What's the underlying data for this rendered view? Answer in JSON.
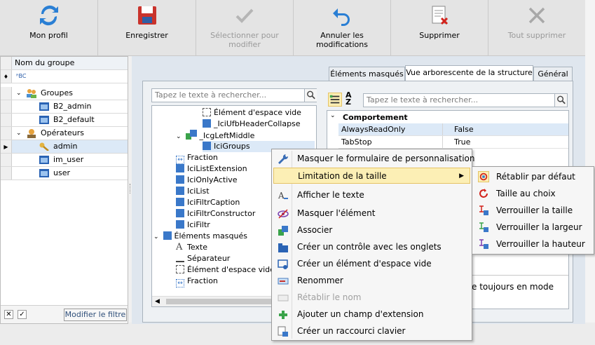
{
  "toolbar": {
    "mon_profil": "Mon profil",
    "enregistrer": "Enregistrer",
    "selectionner": "Sélectionner pour modifier",
    "annuler": "Annuler les modifications",
    "supprimer": "Supprimer",
    "tout_supprimer": "Tout supprimer"
  },
  "left_panel": {
    "header": "Nom du groupe",
    "filter_icon_text": "ᴿBC",
    "rows": {
      "groupes": "Groupes",
      "b2_admin": "B2_admin",
      "b2_default": "B2_default",
      "operateurs": "Opérateurs",
      "admin": "admin",
      "im_user": "im_user",
      "user": "user"
    },
    "modifier_filtre": "Modifier le filtre"
  },
  "tabs": {
    "elements_masques": "Éléments masqués",
    "vue_arborescente": "Vue arborescente de la structure",
    "general": "Général"
  },
  "tree_search_placeholder": "Tapez le texte à rechercher...",
  "props_search_placeholder": "Tapez le texte à rechercher...",
  "tree": {
    "element_espace_vide_1": "Élément d'espace vide",
    "ici_ufb_header_collapse": "_IciUfbHeaderCollapse",
    "icg_left_middle": "_IcgLeftMiddle",
    "ici_groups": "IciGroups",
    "fraction_1": "Fraction",
    "ici_list_extension": "IciListExtension",
    "ici_only_active": "IciOnlyActive",
    "ici_list": "IciList",
    "ici_filtr_caption": "IciFiltrCaption",
    "ici_filtr_constructor": "IciFiltrConstructor",
    "ici_filtr": "IciFiltr",
    "elements_masques": "Éléments masqués",
    "texte": "Texte",
    "separateur": "Séparateur",
    "element_espace_vide_2": "Élément d'espace vide",
    "fraction_2": "Fraction"
  },
  "props": {
    "category": "Comportement",
    "rows": [
      {
        "name": "AlwaysReadOnly",
        "value": "False"
      },
      {
        "name": "TabStop",
        "value": "True"
      }
    ],
    "description_fragment": "e toujours en mode"
  },
  "context_menu": {
    "masquer_formulaire": "Masquer le formulaire de personnalisation",
    "limitation_taille": "Limitation de la taille",
    "afficher_texte": "Afficher le texte",
    "masquer_element": "Masquer l'élément",
    "associer": "Associer",
    "creer_controle_onglets": "Créer un contrôle avec les onglets",
    "creer_element_espace_vide": "Créer un élément d'espace vide",
    "renommer": "Renommer",
    "retablir_nom": "Rétablir le nom",
    "ajouter_champ_extension": "Ajouter un champ d'extension",
    "creer_raccourci": "Créer un raccourci clavier"
  },
  "submenu": {
    "retablir_defaut": "Rétablir par défaut",
    "taille_au_choix": "Taille au choix",
    "verrouiller_taille": "Verrouiller la taille",
    "verrouiller_largeur": "Verrouiller la largeur",
    "verrouiller_hauteur": "Verrouiller la hauteur"
  },
  "colors": {
    "accent_blue": "#3a78c9",
    "highlight": "#fcefb5",
    "selected_row": "#dce9f7"
  }
}
